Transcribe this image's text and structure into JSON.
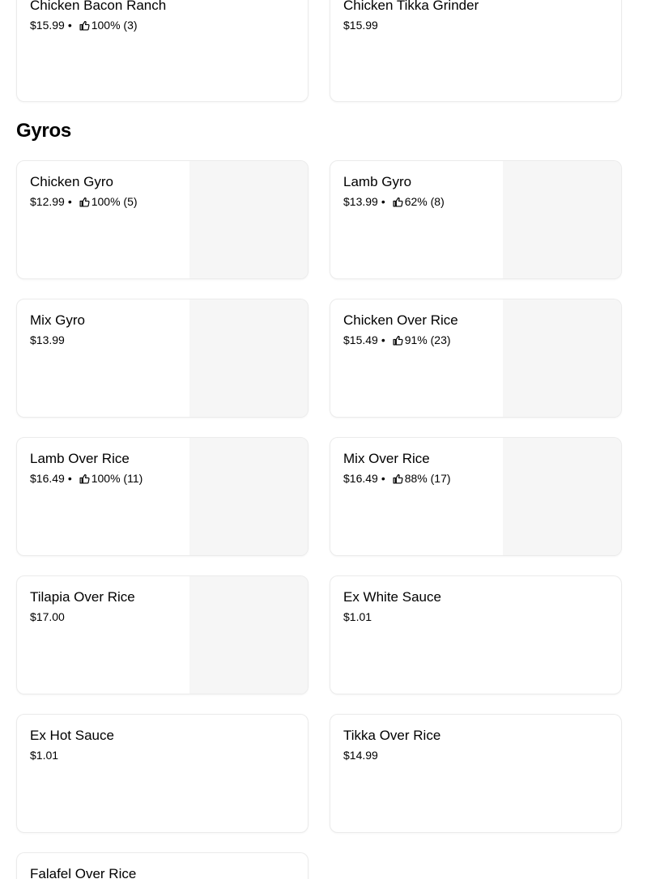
{
  "top_items": [
    {
      "name": "Chicken Bacon Ranch",
      "price": "$15.99",
      "rating": "100% (3)"
    },
    {
      "name": "Chicken Tikka Grinder",
      "price": "$15.99"
    }
  ],
  "section": {
    "title": "Gyros"
  },
  "items": [
    {
      "name": "Chicken Gyro",
      "price": "$12.99",
      "rating": "100% (5)"
    },
    {
      "name": "Lamb Gyro",
      "price": "$13.99",
      "rating": "62% (8)"
    },
    {
      "name": "Mix Gyro",
      "price": "$13.99"
    },
    {
      "name": "Chicken Over Rice",
      "price": "$15.49",
      "rating": "91% (23)"
    },
    {
      "name": "Lamb Over Rice",
      "price": "$16.49",
      "rating": "100% (11)"
    },
    {
      "name": "Mix Over Rice",
      "price": "$16.49",
      "rating": "88% (17)"
    },
    {
      "name": "Tilapia Over Rice",
      "price": "$17.00"
    },
    {
      "name": "Ex White Sauce",
      "price": "$1.01"
    },
    {
      "name": "Ex Hot Sauce",
      "price": "$1.01"
    },
    {
      "name": "Tikka Over Rice",
      "price": "$14.99"
    },
    {
      "name": "Falafel Over Rice"
    }
  ],
  "icons": {
    "rating": "thumbs-up-icon"
  },
  "separator": "•"
}
